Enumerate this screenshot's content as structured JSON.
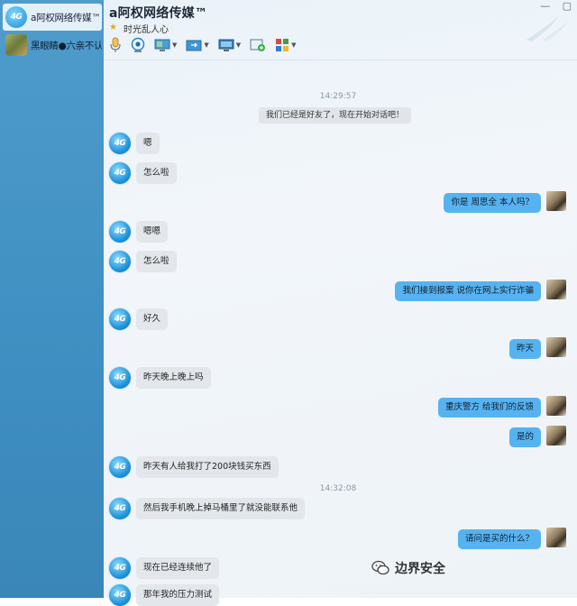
{
  "sidebar": {
    "contacts": [
      {
        "name": "a阿权网络传媒™",
        "active": true,
        "icon": "4g-icon"
      },
      {
        "name": "黑眼睛●六亲不认",
        "active": false,
        "icon": "photo-avatar"
      }
    ]
  },
  "header": {
    "title": "a阿权网络传媒™",
    "signature": "时光乱人心",
    "icons": [
      "microphone-icon",
      "camera-icon",
      "screen-share-icon",
      "file-transfer-icon",
      "remote-desktop-icon",
      "add-app-icon",
      "apps-grid-icon"
    ]
  },
  "chat": {
    "timestamps": [
      "14:29:57",
      "14:32:08"
    ],
    "system_message": "我们已经是好友了，现在开始对话吧！",
    "avatar_label": "4G",
    "messages": [
      {
        "side": "in",
        "text": "嗯"
      },
      {
        "side": "in",
        "text": "怎么啦"
      },
      {
        "side": "out",
        "text": "你是 周思全 本人吗？"
      },
      {
        "side": "in",
        "text": "嗯嗯"
      },
      {
        "side": "in",
        "text": "怎么啦"
      },
      {
        "side": "out",
        "text": "我们接到报案 说你在网上实行诈骗"
      },
      {
        "side": "in",
        "text": "好久"
      },
      {
        "side": "out",
        "text": "昨天"
      },
      {
        "side": "in",
        "text": "昨天晚上晚上吗"
      },
      {
        "side": "out",
        "text": "重庆警方 给我们的反馈"
      },
      {
        "side": "out",
        "text": "是的"
      },
      {
        "side": "in",
        "text": "昨天有人给我打了200块钱买东西"
      },
      {
        "side": "in",
        "text": "然后我手机晚上掉马桶里了就没能联系他"
      },
      {
        "side": "out",
        "text": "请问是买的什么？"
      },
      {
        "side": "in",
        "text": "现在已经连续他了"
      },
      {
        "side": "in",
        "text": "那年我的压力测试"
      }
    ]
  },
  "watermark": {
    "text": "边界安全"
  },
  "colors": {
    "sidebar": "#3f8fc2",
    "bubble_out": "#57b3f0",
    "bubble_in": "#e3e7eb"
  }
}
